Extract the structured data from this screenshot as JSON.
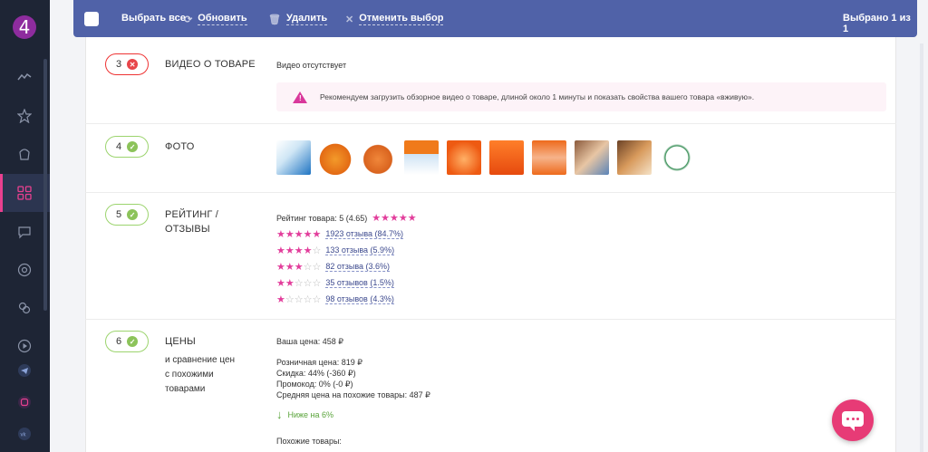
{
  "sidebar": {
    "logo": "4",
    "icons": [
      "activity-icon",
      "star-icon",
      "basket-icon",
      "grid-icon",
      "chat-icon",
      "chrome-icon",
      "brain-icon",
      "youtube-icon",
      "telegram-icon",
      "instagram-icon",
      "vk-icon"
    ],
    "active": "grid-icon"
  },
  "topbar": {
    "select_all": "Выбрать все",
    "refresh": "Обновить",
    "delete": "Удалить",
    "cancel": "Отменить выбор",
    "selected": "Выбрано 1 из 1"
  },
  "rows": {
    "video": {
      "num": "3",
      "title": "ВИДЕО О ТОВАРЕ",
      "value": "Видео отсутствует",
      "warning": "Рекомендуем загрузить обзорное видео о товаре, длиной около 1 минуты и показать свойства вашего товара «вживую»."
    },
    "photo": {
      "num": "4",
      "title": "ФОТО"
    },
    "rating": {
      "num": "5",
      "title1": "РЕЙТИНГ /",
      "title2": "ОТЗЫВЫ",
      "summary": "Рейтинг товара: 5 (4.65)",
      "reviews": [
        {
          "stars": 5,
          "text": "1923 отзыва (84.7%)"
        },
        {
          "stars": 4,
          "text": "133 отзыва (5.9%)"
        },
        {
          "stars": 3,
          "text": "82 отзыва (3.6%)"
        },
        {
          "stars": 2,
          "text": "35 отзывов (1.5%)"
        },
        {
          "stars": 1,
          "text": "98 отзывов (4.3%)"
        }
      ]
    },
    "price": {
      "num": "6",
      "title": "ЦЕНЫ",
      "sub1": "и сравнение цен",
      "sub2": "с похожими",
      "sub3": "товарами",
      "your_price": "Ваша цена: 458 ₽",
      "retail": "Розничная цена: 819 ₽",
      "discount": "Скидка: 44% (-360 ₽)",
      "promo": "Промокод: 0% (-0 ₽)",
      "avg": "Средняя цена на похожие товары: 487 ₽",
      "lower": "Ниже на 6%",
      "similar": "Похожие товары:"
    }
  },
  "colors": {
    "accent": "#5062a8",
    "pink": "#e23d9b",
    "green": "#8cc35a",
    "red": "#e8454a"
  }
}
